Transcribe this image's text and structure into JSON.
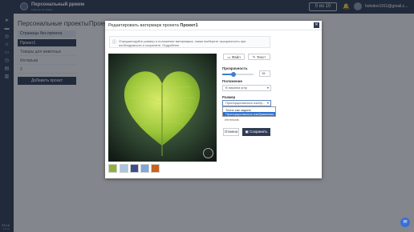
{
  "topbar": {
    "mode_title": "Персональный режим",
    "mode_subtitle": "Клиенты по отбору",
    "counter": "0 из 10",
    "user_email": "holodov1911@gmail.c..."
  },
  "sidebar": {
    "clock": "23:16",
    "date": "21.12"
  },
  "projects": {
    "heading": "Персональные проекты",
    "no_project": "Страницы без проекта",
    "items": [
      "Проект1",
      "Товары для животных",
      "Интерьер",
      "2"
    ],
    "add_button": "Добавить проект"
  },
  "background_heading": "Проект1",
  "modal": {
    "title_prefix": "Редактировать ватермарк проекта",
    "title_project": "Проект1",
    "info_text": "Отредактируйте размер и положение ватермарка, также выберите прозрачность при необходимости и сохраните. Подробнее",
    "file_button": "Файл",
    "text_button": "Текст",
    "opacity_label": "Прозрачность",
    "opacity_value": "15",
    "opacity_level": 0.35,
    "position_label": "Положение",
    "position_value": "В нижнем углу",
    "size_label": "Размер",
    "size_value": "Пропорционально изобр...",
    "size_options": [
      "Точно как задано",
      "Пропорционально изображению"
    ],
    "size_extra_option": "Интенсив",
    "cancel_button": "Отмена",
    "save_button": "Сохранить"
  },
  "colors": {
    "nav_bg": "#2f3b52",
    "accent": "#3f7fd0",
    "leaf_green": "#9cc63a"
  }
}
